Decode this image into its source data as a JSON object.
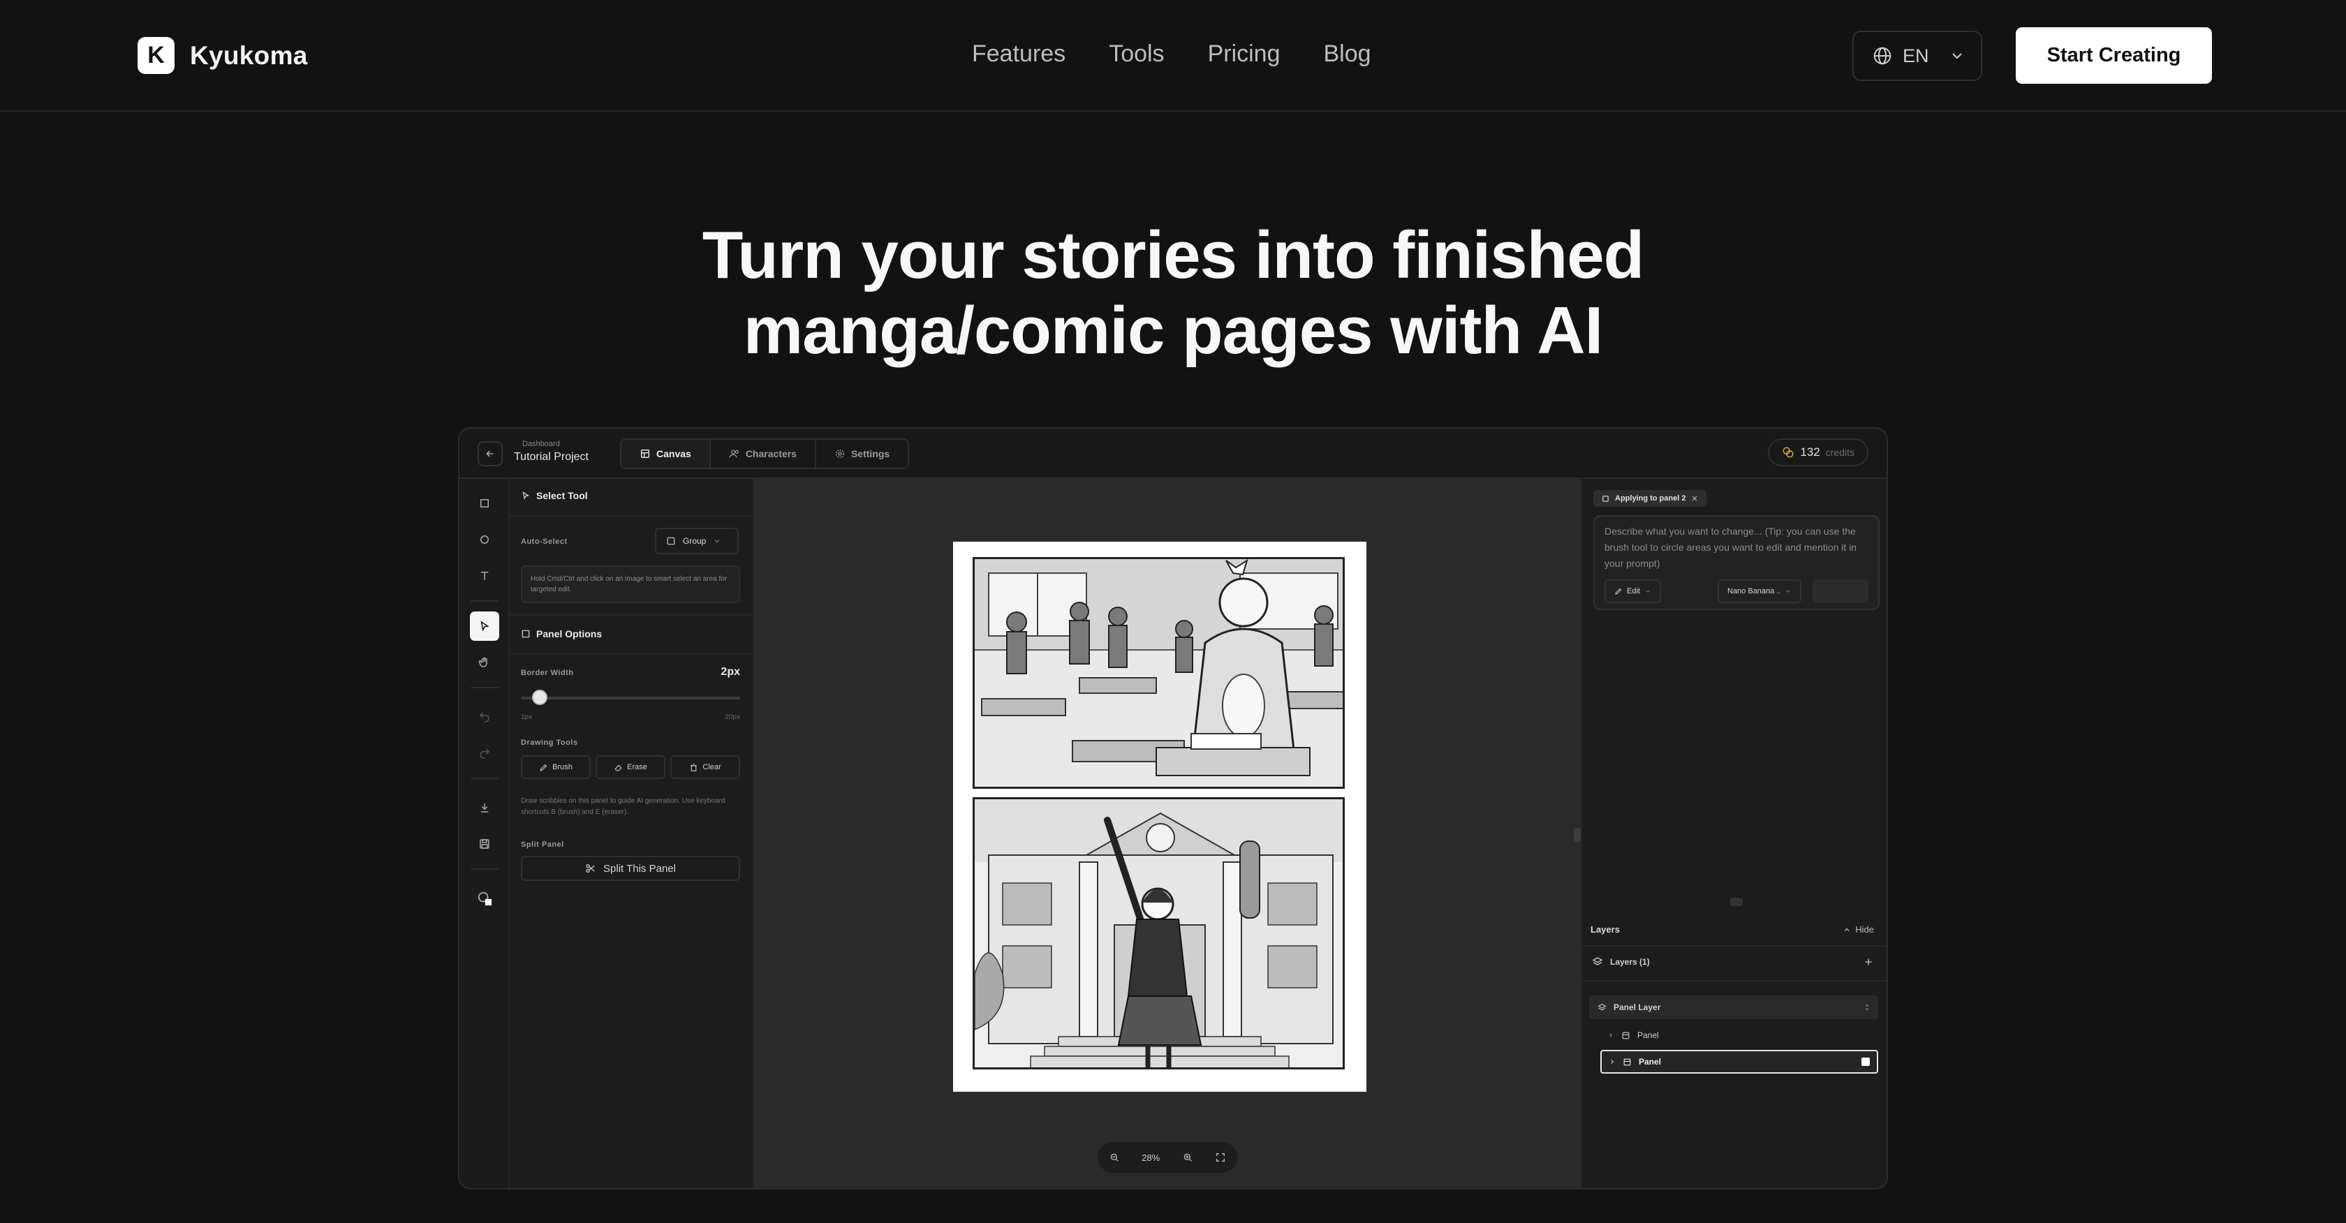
{
  "nav": {
    "brand_letter": "K",
    "brand_name": "Kyukoma",
    "links": [
      "Features",
      "Tools",
      "Pricing",
      "Blog"
    ],
    "language": "EN",
    "cta": "Start Creating"
  },
  "hero": {
    "line1": "Turn your stories into finished",
    "line2": "manga/comic pages with AI"
  },
  "app": {
    "breadcrumb_parent": "Dashboard",
    "project_name": "Tutorial Project",
    "tabs": [
      {
        "label": "Canvas",
        "icon": "layout-icon",
        "active": true
      },
      {
        "label": "Characters",
        "icon": "users-icon",
        "active": false
      },
      {
        "label": "Settings",
        "icon": "gear-icon",
        "active": false
      }
    ],
    "credits": {
      "count": "132",
      "unit": "credits",
      "accent": "#d9a23b"
    },
    "tool_panel": {
      "title": "Select Tool",
      "auto_select_label": "Auto-Select",
      "auto_select_value": "Group",
      "auto_select_hint": "Hold Cmd/Ctrl and click on an image to smart select an area for targeted edit.",
      "panel_options_title": "Panel Options",
      "border_width_label": "Border Width",
      "border_width_value": "2px",
      "border_width_fraction": 0.05,
      "slider_min": "1px",
      "slider_max": "20px",
      "drawing_tools_label": "Drawing Tools",
      "drawing_tools": [
        "Brush",
        "Erase",
        "Clear"
      ],
      "drawing_desc": "Draw scribbles on this panel to guide AI generation. Use keyboard shortcuts B (brush) and E (eraser).",
      "split_panel_label": "Split Panel",
      "split_button": "Split This Panel"
    },
    "canvas": {
      "zoom": "28%"
    },
    "right_panel": {
      "applying_chip": "Applying to panel 2",
      "prompt_placeholder": "Describe what you want to change... (Tip: you can use the brush tool to circle areas you want to edit and mention it in your prompt)",
      "mode_button": "Edit",
      "model_select": "Nano Banana ..",
      "layers_title": "Layers",
      "hide_label": "Hide",
      "layers_count": "Layers (1)",
      "layer_group": "Panel Layer",
      "layer_items": [
        "Panel",
        "Panel"
      ]
    }
  }
}
